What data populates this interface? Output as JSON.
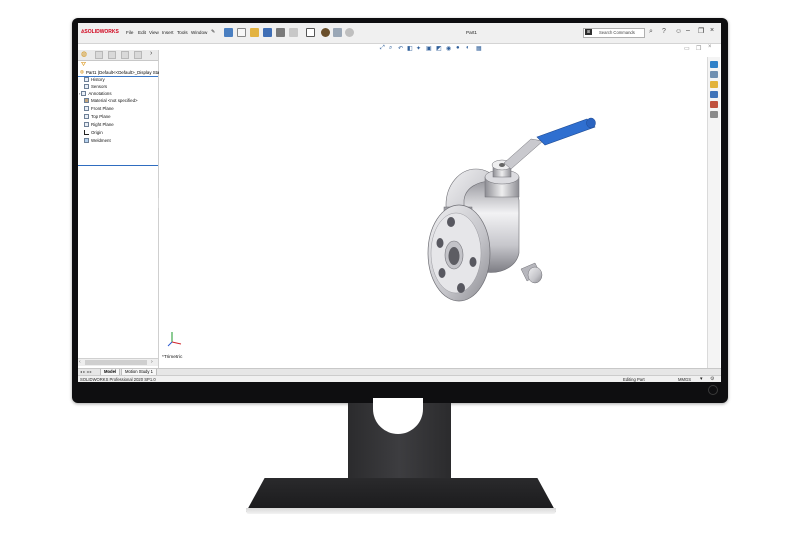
{
  "app": {
    "logo_text": "SOLIDWORKS",
    "menu": [
      "File",
      "Edit",
      "View",
      "Insert",
      "Tools",
      "Window"
    ],
    "document_title": "Part1",
    "search_text": "Search Commands"
  },
  "feature_manager": {
    "root": "Part1 (Default<<Default>_Display State",
    "items": [
      {
        "label": "History",
        "icon": "history-icon"
      },
      {
        "label": "Sensors",
        "icon": "sensor-icon"
      },
      {
        "label": "Annotations",
        "icon": "annotation-icon"
      },
      {
        "label": "Material <not specified>",
        "icon": "material-icon"
      },
      {
        "label": "Front Plane",
        "icon": "plane-icon"
      },
      {
        "label": "Top Plane",
        "icon": "plane-icon"
      },
      {
        "label": "Right Plane",
        "icon": "plane-icon"
      },
      {
        "label": "Origin",
        "icon": "origin-icon"
      },
      {
        "label": "Weldment",
        "icon": "weldment-icon"
      }
    ]
  },
  "graphics": {
    "view_label": "*Trimetric",
    "handle_color": "#2f6fd0"
  },
  "bottom_tabs": [
    "Model",
    "Motion Study 1"
  ],
  "status": {
    "left": "SOLIDWORKS Professional 2020 SP1.0",
    "editing": "Editing Part",
    "units": "MMGS"
  }
}
